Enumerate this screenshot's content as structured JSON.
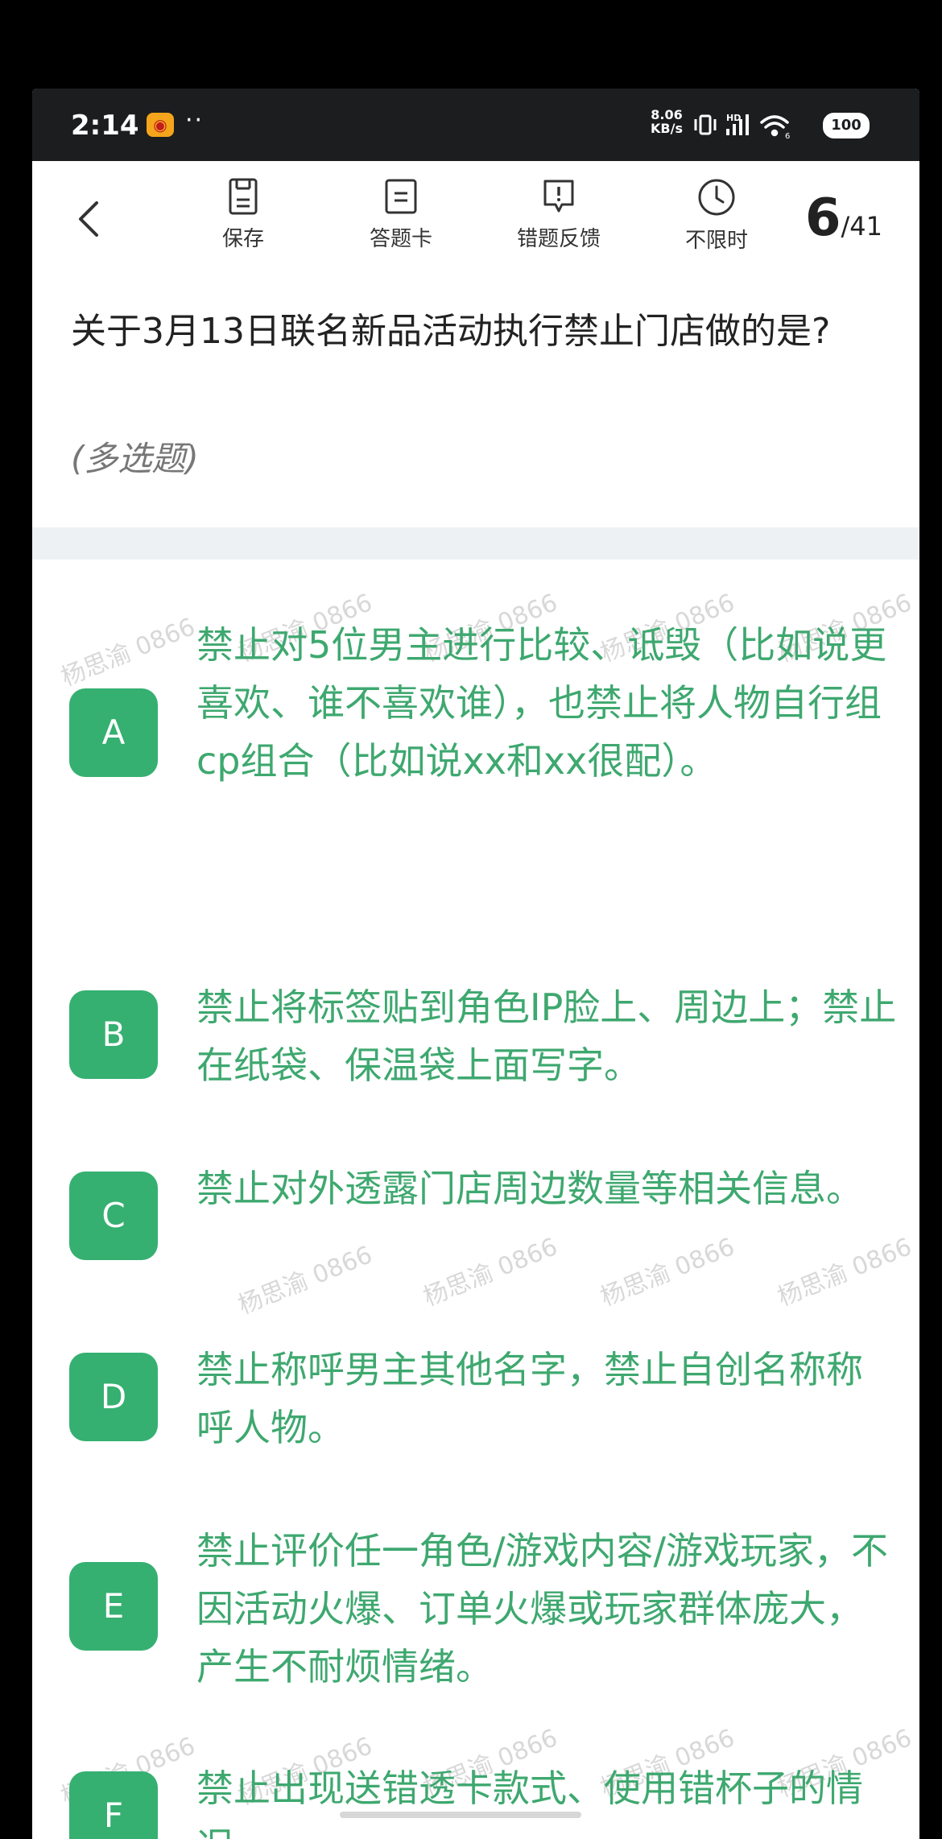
{
  "status_bar": {
    "time": "2:14",
    "speed_value": "8.06",
    "speed_unit": "KB/s",
    "battery": "100",
    "signal_label": "HD",
    "wifi_label": "6"
  },
  "toolbar": {
    "save_label": "保存",
    "answer_card_label": "答题卡",
    "feedback_label": "错题反馈",
    "timer_label": "不限时",
    "current": "6",
    "total": "/41"
  },
  "question": {
    "text": "关于3月13日联名新品活动执行禁止门店做的是?",
    "type": "(多选题)"
  },
  "watermark": "杨思渝 0866",
  "options": [
    {
      "letter": "A",
      "text": "禁止对5位男主进行比较、诋毁（比如说更喜欢、谁不喜欢谁），也禁止将人物自行组cp组合（比如说xx和xx很配）。"
    },
    {
      "letter": "B",
      "text": "禁止将标签贴到角色IP脸上、周边上；禁止在纸袋、保温袋上面写字。"
    },
    {
      "letter": "C",
      "text": "禁止对外透露门店周边数量等相关信息。"
    },
    {
      "letter": "D",
      "text": "禁止称呼男主其他名字，禁止自创名称称呼人物。"
    },
    {
      "letter": "E",
      "text": "禁止评价任一角色/游戏内容/游戏玩家，不因活动火爆、订单火爆或玩家群体庞大，产生不耐烦情绪。"
    },
    {
      "letter": "F",
      "text": "禁止出现送错透卡款式、使用错杯子的情况。"
    }
  ],
  "colors": {
    "accent": "#35b071",
    "option_text": "#3ea86f",
    "status_bar": "#1c1d1f"
  }
}
